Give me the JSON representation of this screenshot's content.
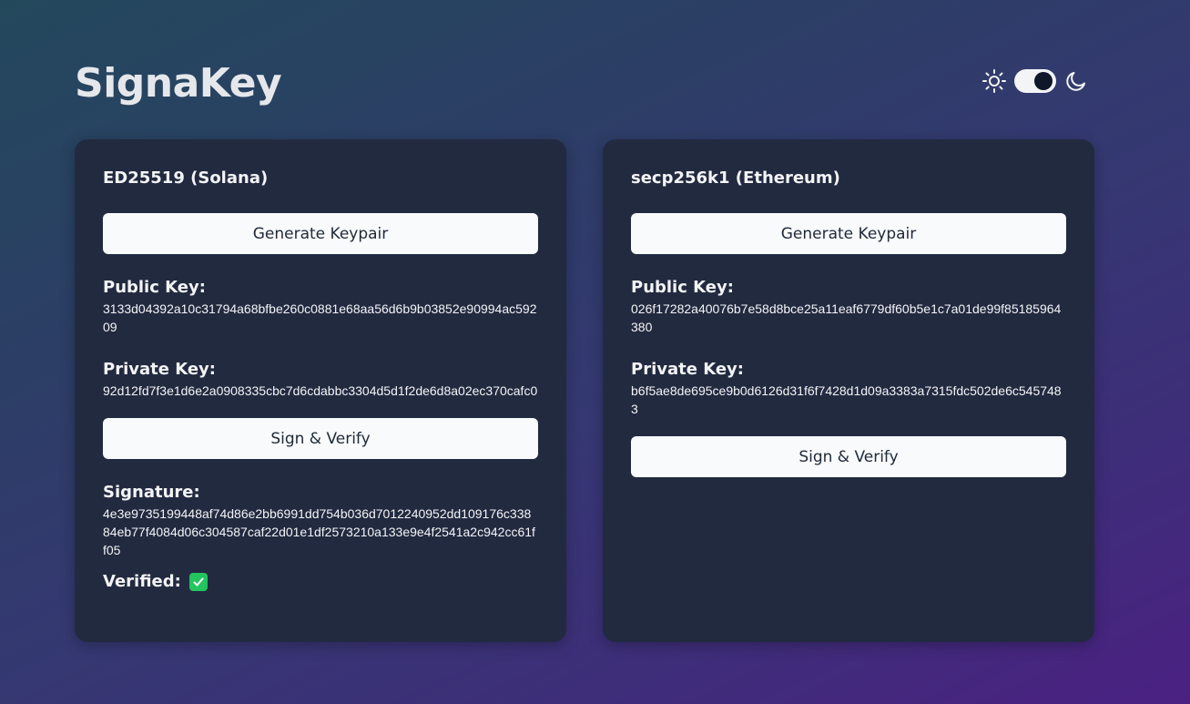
{
  "app": {
    "title": "SignaKey"
  },
  "theme": {
    "mode": "dark",
    "light_icon": "sun-icon",
    "dark_icon": "moon-icon"
  },
  "cards": [
    {
      "title": "ED25519 (Solana)",
      "generate_label": "Generate Keypair",
      "public_key_label": "Public Key:",
      "public_key": "3133d04392a10c31794a68bfbe260c0881e68aa56d6b9b03852e90994ac59209",
      "private_key_label": "Private Key:",
      "private_key": "92d12fd7f3e1d6e2a0908335cbc7d6cdabbc3304d5d1f2de6d8a02ec370cafc0",
      "sign_label": "Sign & Verify",
      "signature_label": "Signature:",
      "signature": "4e3e9735199448af74d86e2bb6991dd754b036d7012240952dd109176c33884eb77f4084d06c304587caf22d01e1df2573210a133e9e4f2541a2c942cc61ff05",
      "verified_label": "Verified:",
      "verified_icon": "check-icon"
    },
    {
      "title": "secp256k1 (Ethereum)",
      "generate_label": "Generate Keypair",
      "public_key_label": "Public Key:",
      "public_key": "026f17282a40076b7e58d8bce25a11eaf6779df60b5e1c7a01de99f85185964380",
      "private_key_label": "Private Key:",
      "private_key": "b6f5ae8de695ce9b0d6126d31f6f7428d1d09a3383a7315fdc502de6c5457483",
      "sign_label": "Sign & Verify"
    }
  ],
  "colors": {
    "accent_check": "#22c55e",
    "card_bg": "#222a40"
  }
}
